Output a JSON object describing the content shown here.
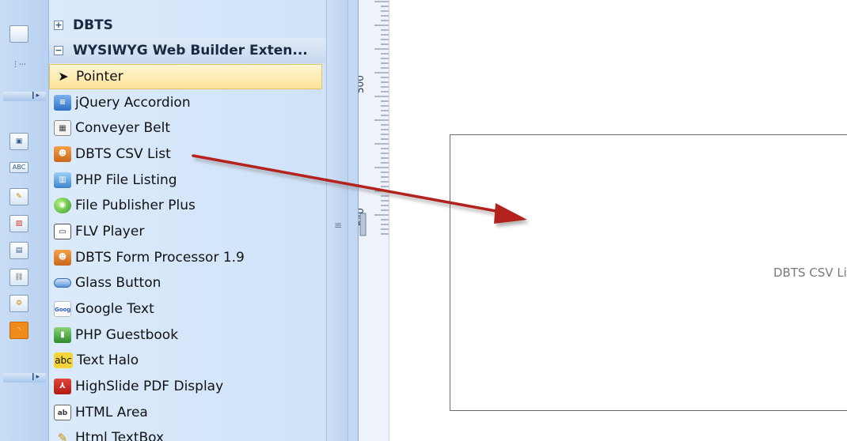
{
  "toolbox": {
    "groups": {
      "dbts": {
        "label": "DBTS",
        "toggle": "+"
      },
      "extensions": {
        "label": "WYSIWYG Web Builder Exten...",
        "toggle": "−"
      }
    },
    "tools": [
      {
        "label": "Pointer",
        "icon": "pointer-icon"
      },
      {
        "label": "jQuery Accordion",
        "icon": "accordion-icon"
      },
      {
        "label": "Conveyer Belt",
        "icon": "conveyer-belt-icon"
      },
      {
        "label": "DBTS CSV List",
        "icon": "dbts-person-icon"
      },
      {
        "label": "PHP File Listing",
        "icon": "file-listing-icon"
      },
      {
        "label": "File Publisher Plus",
        "icon": "globe-icon"
      },
      {
        "label": "FLV Player",
        "icon": "flv-player-icon"
      },
      {
        "label": "DBTS Form Processor 1.9",
        "icon": "dbts-person-icon"
      },
      {
        "label": "Glass Button",
        "icon": "glass-button-icon"
      },
      {
        "label": "Google Text",
        "icon": "google-icon"
      },
      {
        "label": "PHP Guestbook",
        "icon": "guestbook-icon"
      },
      {
        "label": "Text Halo",
        "icon": "abc-icon",
        "icon_text": "abc"
      },
      {
        "label": "HighSlide PDF Display",
        "icon": "pdf-icon"
      },
      {
        "label": "HTML Area",
        "icon": "html-area-icon"
      },
      {
        "label": "Html TextBox",
        "icon": "textbox-icon"
      }
    ]
  },
  "icon_strip": {
    "icons": [
      "layout-icon",
      "tree-icon",
      "image-icon",
      "label-icon",
      "edit-icon",
      "picture-icon",
      "page-icon",
      "link-icon",
      "settings-icon",
      "rss-icon"
    ],
    "label_icon_text": "ABC"
  },
  "ruler": {
    "marks": [
      "500",
      "640"
    ]
  },
  "canvas": {
    "placeholder_label": "DBTS CSV List"
  },
  "colors": {
    "arrow": "#b3201f",
    "selection": "#fbe39a"
  }
}
